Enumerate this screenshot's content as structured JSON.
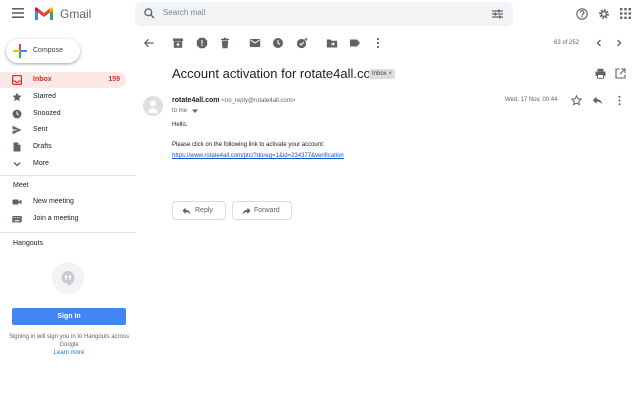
{
  "app": {
    "name": "Gmail"
  },
  "search": {
    "placeholder": "Search mail"
  },
  "compose": {
    "label": "Compose"
  },
  "sidebar": {
    "items": [
      {
        "label": "Inbox",
        "count": "159",
        "active": true
      },
      {
        "label": "Starred"
      },
      {
        "label": "Snoozed"
      },
      {
        "label": "Sent"
      },
      {
        "label": "Drafts"
      },
      {
        "label": "More"
      }
    ],
    "meet": {
      "title": "Meet",
      "items": [
        {
          "label": "New meeting"
        },
        {
          "label": "Join a meeting"
        }
      ]
    },
    "hangouts": {
      "title": "Hangouts",
      "signin_label": "Sign In",
      "hint": "Signing in will sign you in to Hangouts across Google",
      "learn_more": "Learn more"
    }
  },
  "toolbar": {
    "pager": "63 of 252"
  },
  "message": {
    "subject": "Account activation for rotate4all.com",
    "label": "Inbox",
    "label_close": "×",
    "sender_name": "rotate4all.com",
    "sender_email": "<no_reply@rotate4all.com>",
    "to": "to me",
    "date": "Wed, 17 Nov, 00:44",
    "greeting": "Hello,",
    "body": "Please click on the following link to activate your account:",
    "link": "https://www.rotate4all.com/ptc/?doreg=1&id=234377&verification"
  },
  "actions": {
    "reply": "Reply",
    "forward": "Forward"
  },
  "colors": {
    "accent": "#d93025",
    "link": "#1155cc",
    "signin": "#4285f4"
  }
}
